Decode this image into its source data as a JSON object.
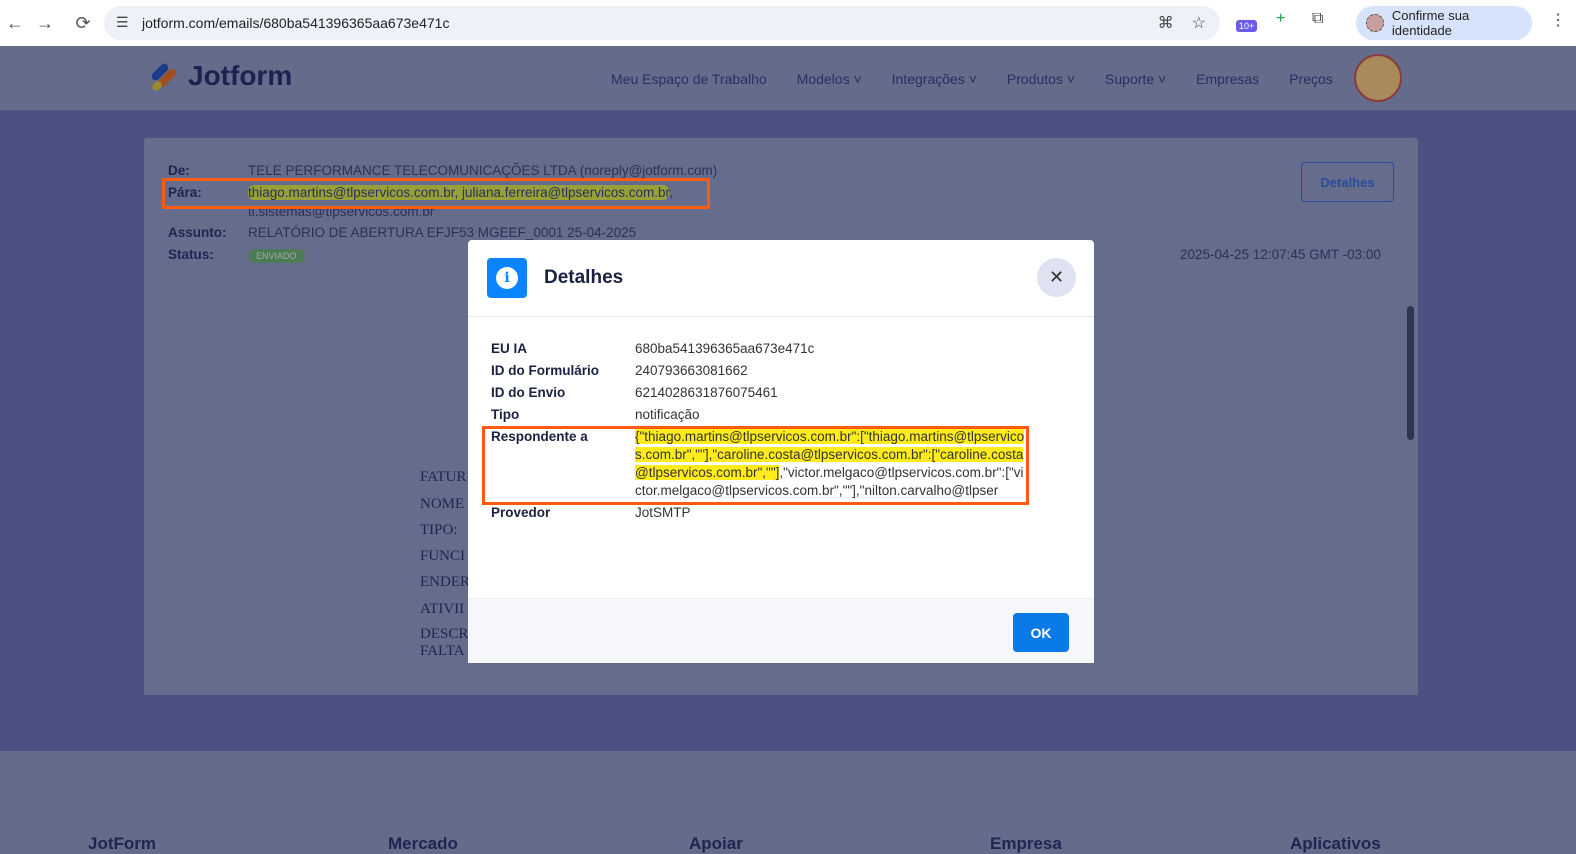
{
  "browser": {
    "url": "jotform.com/emails/680ba541396365aa673e471c",
    "identity_label": "Confirme sua identidade",
    "ext_badge": "10+"
  },
  "site": {
    "logo": "Jotform",
    "menu": [
      "Meu Espaço de Trabalho",
      "Modelos",
      "Integrações",
      "Produtos",
      "Suporte",
      "Empresas",
      "Preços"
    ]
  },
  "email": {
    "from_label": "De:",
    "from": "TELE PERFORMANCE TELECOMUNICAÇÕES LTDA (noreply@jotform.com)",
    "to_label": "Pára:",
    "to_line1": "thiago.martins@tlpservicos.com.br, juliana.ferreira@tlpservicos.com.br",
    "to_line1_end": ",",
    "to_line2": "ti.sistemas@tlpservicos.com.br",
    "subject_label": "Assunto:",
    "subject": "RELATÓRIO DE ABERTURA EFJF53 MGEEF_0001 25-04-2025",
    "status_label": "Status:",
    "status": "ENVIADO",
    "date": "2025-04-25 12:07:45 GMT -03:00",
    "details_button": "Detalhes",
    "body_lines": [
      "FATUR",
      "NOME",
      "TIPO:",
      "FUNCI",
      "ENDER",
      "ATIVII",
      "DESCR",
      "FALTA"
    ]
  },
  "modal": {
    "title": "Detalhes",
    "ok": "OK",
    "rows": [
      {
        "k": "EU IA",
        "v": "680ba541396365aa673e471c"
      },
      {
        "k": "ID do Formulário",
        "v": "240793663081662"
      },
      {
        "k": "ID do Envio",
        "v": "6214028631876075461"
      },
      {
        "k": "Tipo",
        "v": "notificação"
      }
    ],
    "respondent_label": "Respondente a",
    "respondent_highlighted": "{\"thiago.martins@tlpservicos.com.br\":[\"thiago.martins@tlpservicos.com.br\",\"\"],\"caroline.costa@tlpservicos.com.br\":[\"caroline.costa@tlpservicos.com.br\",\"\"]",
    "respondent_rest": ",\"victor.melgaco@tlpservicos.com.br\":[\"victor.melgaco@tlpservicos.com.br\",\"\"],\"nilton.carvalho@tlpser",
    "provider_label": "Provedor",
    "provider": "JotSMTP"
  },
  "footer": [
    "JotForm",
    "Mercado",
    "Apoiar",
    "Empresa",
    "Aplicativos"
  ]
}
